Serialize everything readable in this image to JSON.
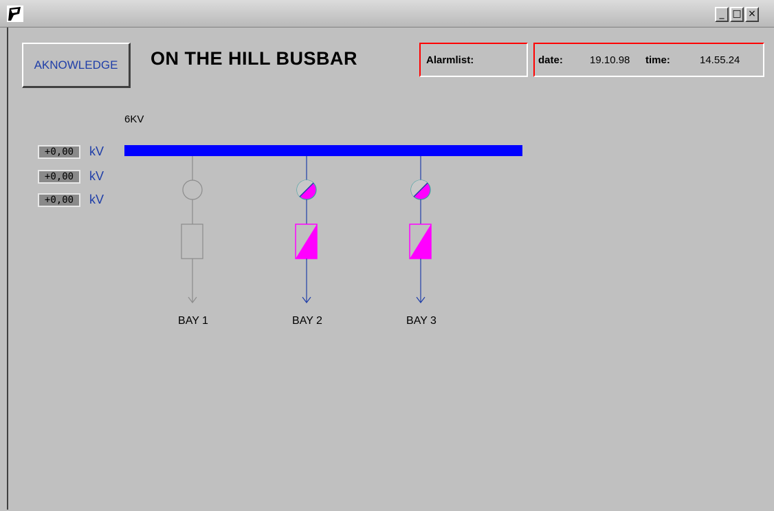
{
  "window": {
    "title": "",
    "controls": {
      "minimize": "_",
      "maximize": "□",
      "close": "×"
    }
  },
  "header": {
    "acknowledge_label": "AKNOWLEDGE",
    "title": "ON THE HILL BUSBAR"
  },
  "alarm_panel": {
    "label": "Alarmlist:"
  },
  "datetime_panel": {
    "date_label": "date:",
    "date_value": "19.10.98",
    "time_label": "time:",
    "time_value": "14.55.24"
  },
  "busbar": {
    "voltage_label": "6KV",
    "color": "#0000ff"
  },
  "measurements": [
    {
      "value": "+0,00",
      "unit": "kV"
    },
    {
      "value": "+0,00",
      "unit": "kV"
    },
    {
      "value": "+0,00",
      "unit": "kV"
    }
  ],
  "bays": [
    {
      "label": "BAY 1",
      "state": "off",
      "color": "#8c8c8c"
    },
    {
      "label": "BAY 2",
      "state": "on",
      "color": "#1f3ea8",
      "fill": "#ff00ff"
    },
    {
      "label": "BAY 3",
      "state": "on",
      "color": "#1f3ea8",
      "fill": "#ff00ff"
    }
  ]
}
